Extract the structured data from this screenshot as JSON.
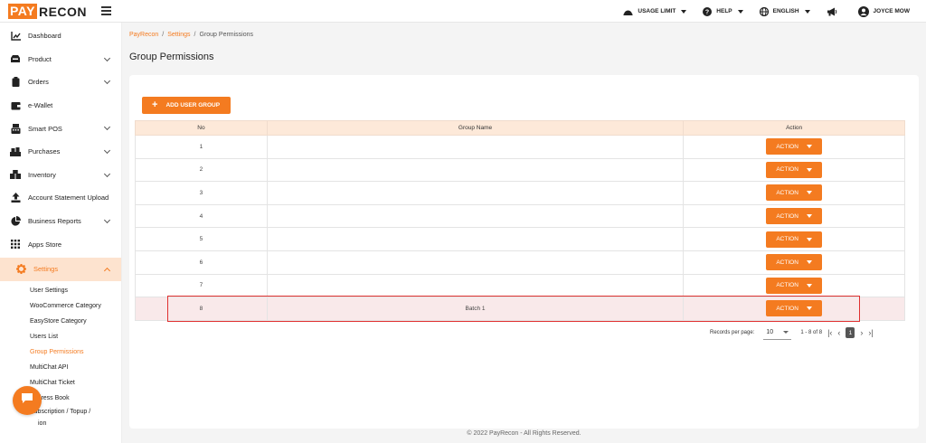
{
  "brand": {
    "logo_part1": "PAY",
    "logo_part2": "RECON",
    "accent": "#f47b20"
  },
  "topbar": {
    "usage_limit": "USAGE LIMIT",
    "help": "HELP",
    "language": "ENGLISH",
    "user_name": "JOYCE MOW"
  },
  "sidebar": {
    "items": [
      {
        "label": "Dashboard",
        "icon": "chart-line-icon"
      },
      {
        "label": "Product",
        "icon": "box-icon"
      },
      {
        "label": "Orders",
        "icon": "clipboard-icon"
      },
      {
        "label": "e-Wallet",
        "icon": "wallet-icon"
      },
      {
        "label": "Smart POS",
        "icon": "pos-icon"
      },
      {
        "label": "Purchases",
        "icon": "cart-icon"
      },
      {
        "label": "Inventory",
        "icon": "boxes-icon"
      },
      {
        "label": "Account Statement Upload",
        "icon": "upload-icon"
      },
      {
        "label": "Business Reports",
        "icon": "pie-chart-icon"
      },
      {
        "label": "Apps Store",
        "icon": "grid-icon"
      },
      {
        "label": "Settings",
        "icon": "gear-icon"
      }
    ],
    "settings_sub": [
      "User Settings",
      "WooCommerce Category",
      "EasyStore Category",
      "Users List",
      "Group Permissions",
      "MultiChat API",
      "MultiChat Ticket",
      "Address Book",
      "Subscription / Topup /",
      "ion"
    ]
  },
  "breadcrumb": {
    "root": "PayRecon",
    "parent": "Settings",
    "current": "Group Permissions",
    "separator": "/"
  },
  "page_title": "Group Permissions",
  "add_button": {
    "plus": "+",
    "label": "ADD USER GROUP"
  },
  "table": {
    "headers": {
      "no": "No",
      "name": "Group Name",
      "action": "Action"
    },
    "action_label": "ACTION",
    "rows": [
      {
        "no": "1",
        "name": ""
      },
      {
        "no": "2",
        "name": ""
      },
      {
        "no": "3",
        "name": ""
      },
      {
        "no": "4",
        "name": ""
      },
      {
        "no": "5",
        "name": ""
      },
      {
        "no": "6",
        "name": ""
      },
      {
        "no": "7",
        "name": ""
      },
      {
        "no": "8",
        "name": "Batch 1"
      }
    ]
  },
  "pagination": {
    "records_per_page_label": "Records per page:",
    "records_per_page": "10",
    "range": "1 - 8 of 8",
    "current_page": "1"
  },
  "footer": "© 2022 PayRecon - All Rights Reserved."
}
